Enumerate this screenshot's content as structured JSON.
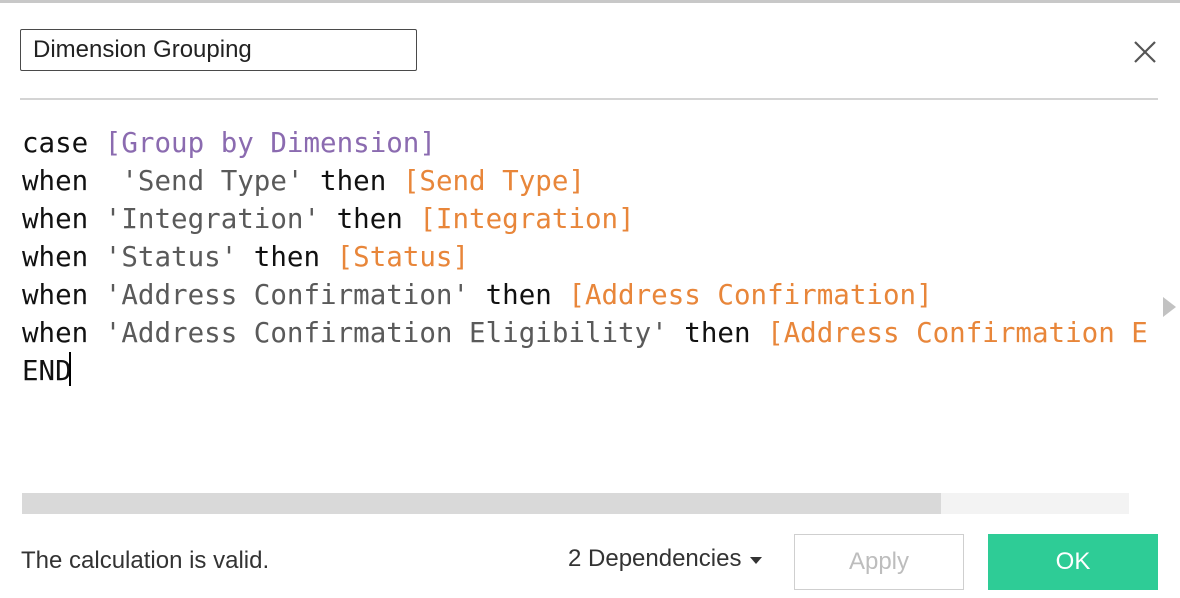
{
  "header": {
    "calc_name": "Dimension Grouping",
    "close_icon": "close-icon"
  },
  "editor": {
    "lines": [
      [
        {
          "type": "keyword",
          "text": "case "
        },
        {
          "type": "param",
          "text": "[Group by Dimension]"
        }
      ],
      [
        {
          "type": "keyword",
          "text": "when "
        },
        {
          "type": "string",
          "text": " 'Send Type'"
        },
        {
          "type": "keyword",
          "text": " then "
        },
        {
          "type": "field",
          "text": "[Send Type]"
        }
      ],
      [
        {
          "type": "keyword",
          "text": "when "
        },
        {
          "type": "string",
          "text": "'Integration'"
        },
        {
          "type": "keyword",
          "text": " then "
        },
        {
          "type": "field",
          "text": "[Integration]"
        }
      ],
      [
        {
          "type": "keyword",
          "text": "when "
        },
        {
          "type": "string",
          "text": "'Status'"
        },
        {
          "type": "keyword",
          "text": " then "
        },
        {
          "type": "field",
          "text": "[Status]"
        }
      ],
      [
        {
          "type": "keyword",
          "text": "when "
        },
        {
          "type": "string",
          "text": "'Address Confirmation'"
        },
        {
          "type": "keyword",
          "text": " then "
        },
        {
          "type": "field",
          "text": "[Address Confirmation]"
        }
      ],
      [
        {
          "type": "keyword",
          "text": "when "
        },
        {
          "type": "string",
          "text": "'Address Confirmation Eligibility'"
        },
        {
          "type": "keyword",
          "text": " then "
        },
        {
          "type": "field",
          "text": "[Address Confirmation Eligibility]"
        }
      ],
      [
        {
          "type": "keyword",
          "text": "END"
        }
      ]
    ],
    "expand_icon": "chevron-right-icon"
  },
  "footer": {
    "status": "The calculation is valid.",
    "dependencies": "2 Dependencies",
    "apply_label": "Apply",
    "ok_label": "OK"
  },
  "colors": {
    "keyword": "#111111",
    "param": "#8b6bb0",
    "string": "#5a5a5a",
    "field": "#e8863a",
    "ok_button": "#2ecc96"
  },
  "scroll": {
    "horizontal_visible_fraction": 0.83
  }
}
